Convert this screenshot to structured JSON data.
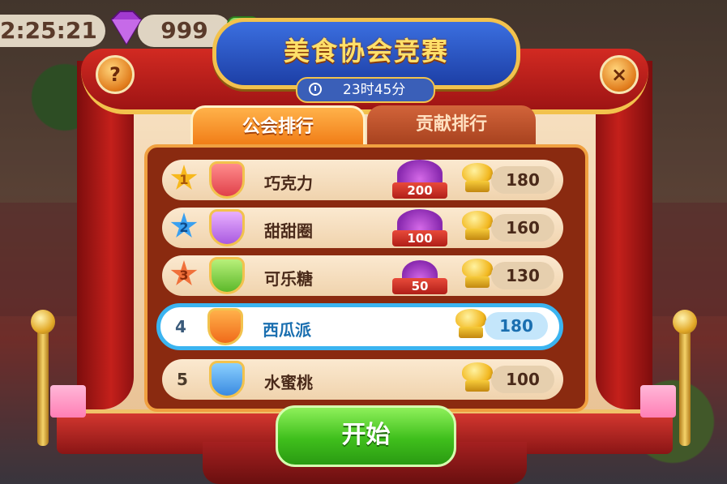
{
  "hud": {
    "timer": "2:25:21",
    "gems": "999"
  },
  "title": "美食协会竞赛",
  "countdown": "23时45分",
  "tabs": {
    "guild": "公会排行",
    "contribution": "贡献排行"
  },
  "rows": [
    {
      "rank": "1",
      "name": "巧克力",
      "gems": "200",
      "score": "180"
    },
    {
      "rank": "2",
      "name": "甜甜圈",
      "gems": "100",
      "score": "160"
    },
    {
      "rank": "3",
      "name": "可乐糖",
      "gems": "50",
      "score": "130"
    },
    {
      "rank": "4",
      "name": "西瓜派",
      "score": "180"
    },
    {
      "rank": "5",
      "name": "水蜜桃",
      "score": "100"
    }
  ],
  "buttons": {
    "help": "?",
    "close": "×",
    "start": "开始"
  },
  "colors": {
    "star_gold": "#f7b81c",
    "star_blue": "#3aa0f0",
    "star_orange": "#f0703a",
    "highlight": "#3bb4f0",
    "start_button": "#3fbf1c"
  },
  "badges": [
    "strawberry-badge-icon",
    "balloon-badge-icon",
    "leaf-badge-icon",
    "gift-badge-icon",
    "lightning-badge-icon"
  ]
}
